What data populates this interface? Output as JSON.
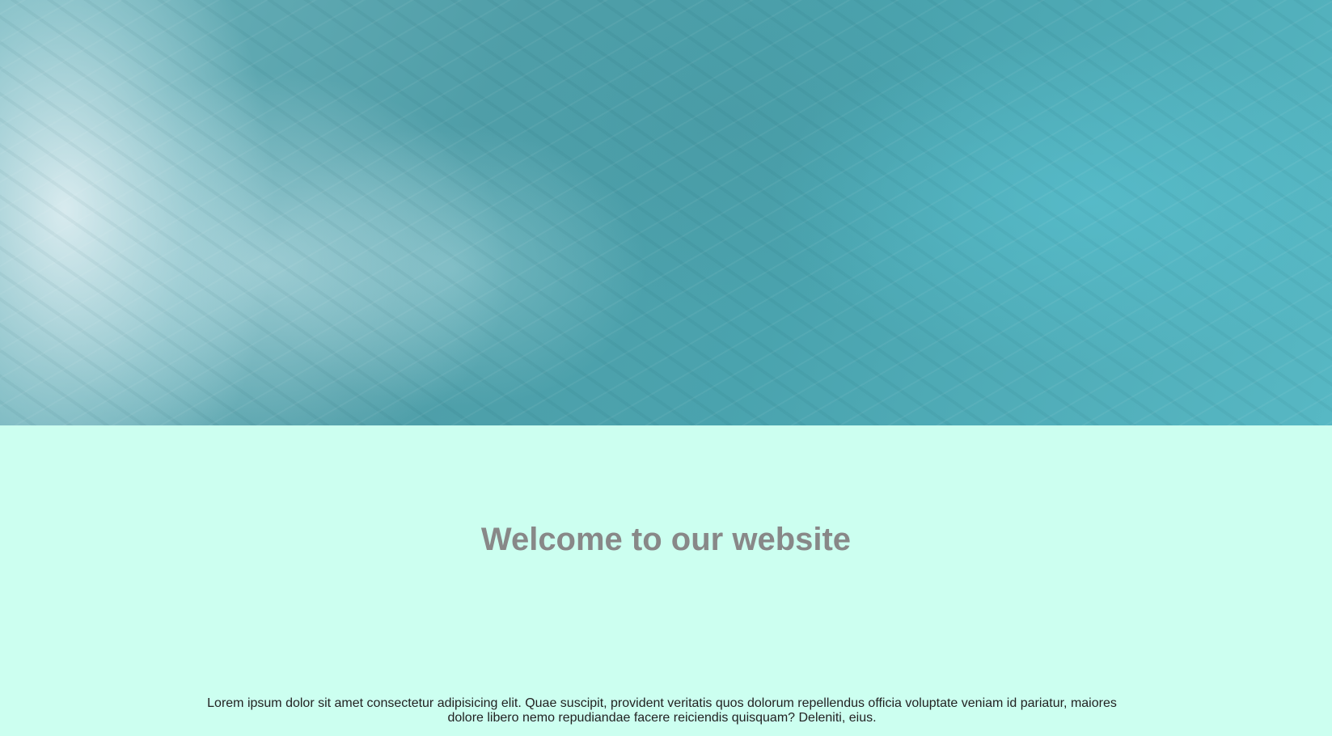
{
  "hero": {
    "image": "ocean-waves-aerial-photo"
  },
  "heading": "Welcome to our website",
  "paragraph": "Lorem ipsum dolor sit amet consectetur adipisicing elit. Quae suscipit, provident veritatis quos dolorum repellendus officia voluptate veniam id pariatur, maiores dolore libero nemo repudiandae facere reiciendis quisquam? Deleniti, eius.",
  "colors": {
    "background": "#ccfff0",
    "heading": "#888888"
  }
}
